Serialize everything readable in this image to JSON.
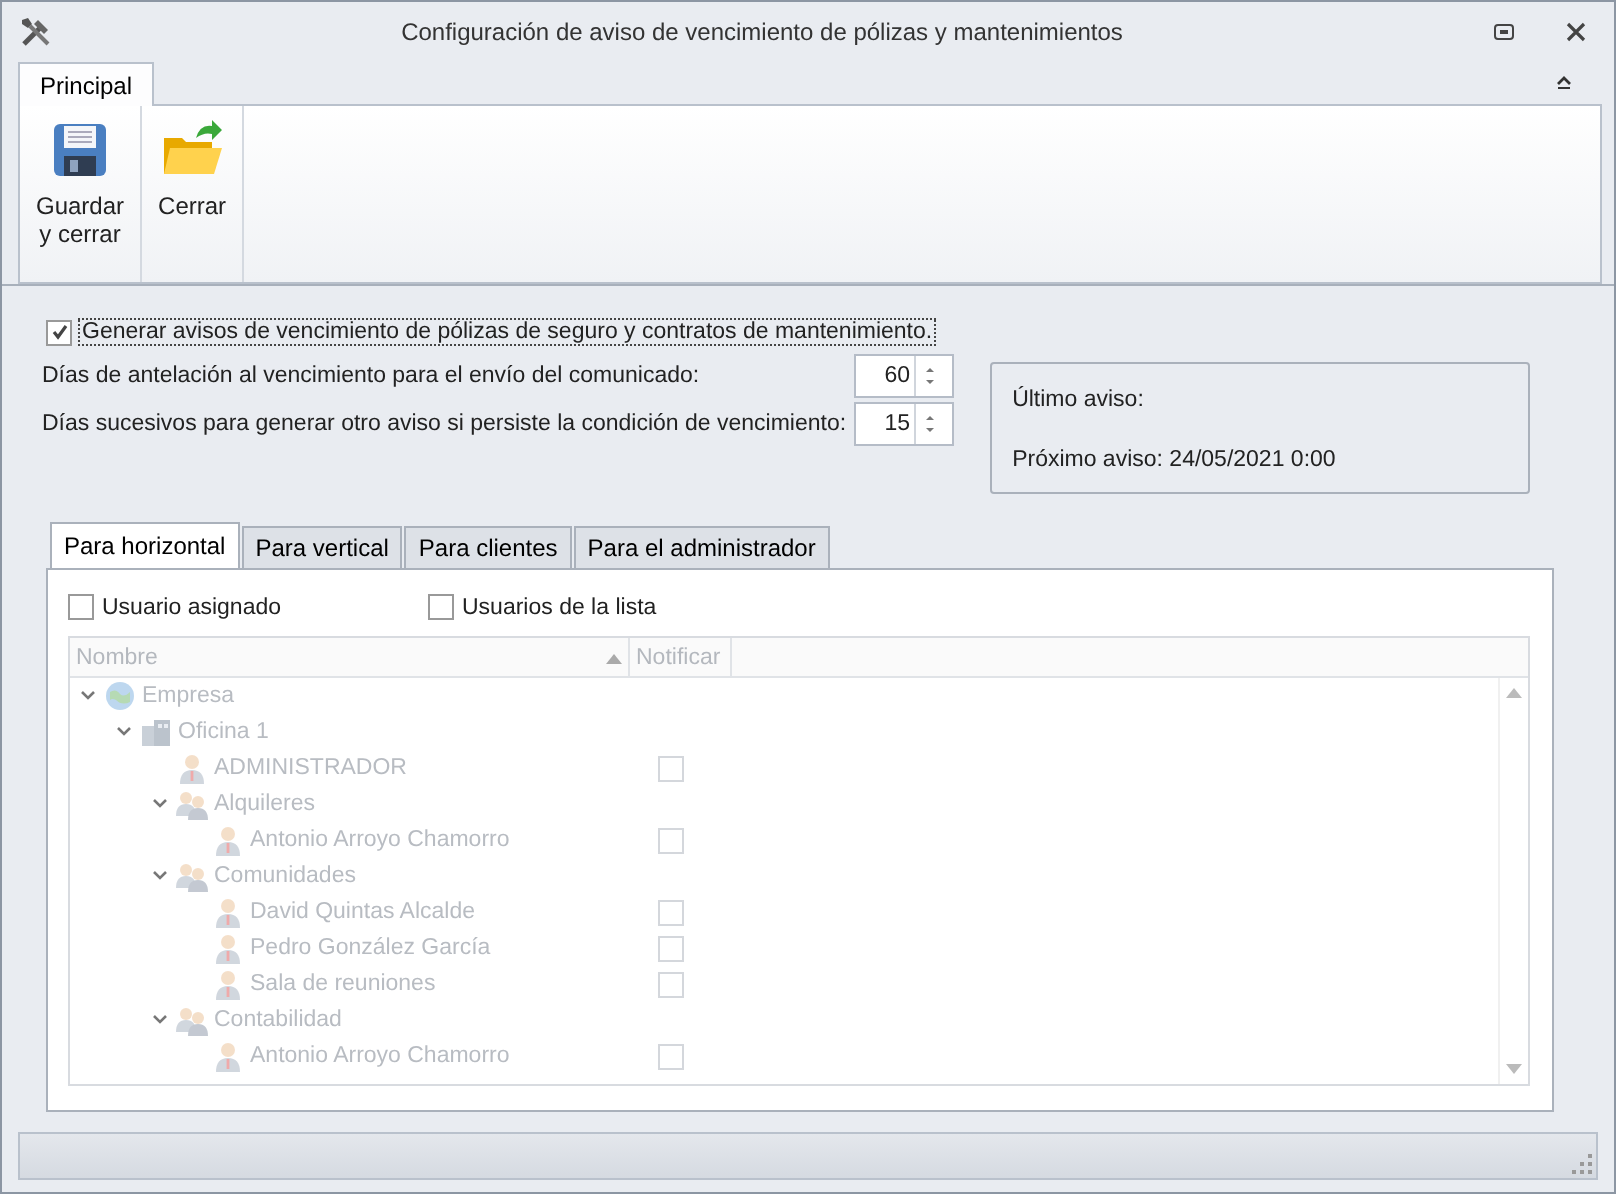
{
  "window": {
    "title": "Configuración de aviso de vencimiento de pólizas y mantenimientos"
  },
  "ribbon": {
    "tabs": [
      {
        "label": "Principal",
        "selected": true
      }
    ],
    "buttons": [
      {
        "label": "Guardar\ny cerrar",
        "kind": "save"
      },
      {
        "label": "Cerrar",
        "kind": "close"
      }
    ]
  },
  "generate": {
    "label": "Generar avisos de vencimiento de pólizas de seguro y contratos de mantenimiento.",
    "checked": true
  },
  "fields": [
    {
      "label": "Días de antelación al vencimiento para el envío del comunicado:",
      "value": "60"
    },
    {
      "label": "Días sucesivos para generar otro aviso si persiste la condición de vencimiento:",
      "value": "15"
    }
  ],
  "info": {
    "last": "Último aviso:",
    "next": "Próximo aviso: 24/05/2021 0:00"
  },
  "tabs": [
    {
      "label": "Para horizontal",
      "selected": true
    },
    {
      "label": "Para vertical",
      "selected": false
    },
    {
      "label": "Para clientes",
      "selected": false
    },
    {
      "label": "Para el administrador",
      "selected": false
    }
  ],
  "options": [
    {
      "label": "Usuario asignado",
      "checked": false
    },
    {
      "label": "Usuarios de la lista",
      "checked": false
    }
  ],
  "tree": {
    "disabled": true,
    "columns": [
      "Nombre",
      "Notificar"
    ],
    "items": [
      {
        "label": "Empresa",
        "kind": "company",
        "expanded": true,
        "children": [
          {
            "label": "Oficina 1",
            "kind": "office",
            "expanded": true,
            "children": [
              {
                "label": "ADMINISTRADOR",
                "kind": "user",
                "notify": false
              },
              {
                "label": "Alquileres",
                "kind": "group",
                "expanded": true,
                "children": [
                  {
                    "label": "Antonio Arroyo Chamorro",
                    "kind": "user",
                    "notify": false
                  }
                ]
              },
              {
                "label": "Comunidades",
                "kind": "group",
                "expanded": true,
                "children": [
                  {
                    "label": "David Quintas Alcalde",
                    "kind": "user",
                    "notify": false
                  },
                  {
                    "label": "Pedro González García",
                    "kind": "user",
                    "notify": false
                  },
                  {
                    "label": "Sala de reuniones",
                    "kind": "user",
                    "notify": false
                  }
                ]
              },
              {
                "label": "Contabilidad",
                "kind": "group",
                "expanded": true,
                "children": [
                  {
                    "label": "Antonio Arroyo Chamorro",
                    "kind": "user",
                    "notify": false
                  }
                ]
              }
            ]
          }
        ]
      }
    ]
  }
}
